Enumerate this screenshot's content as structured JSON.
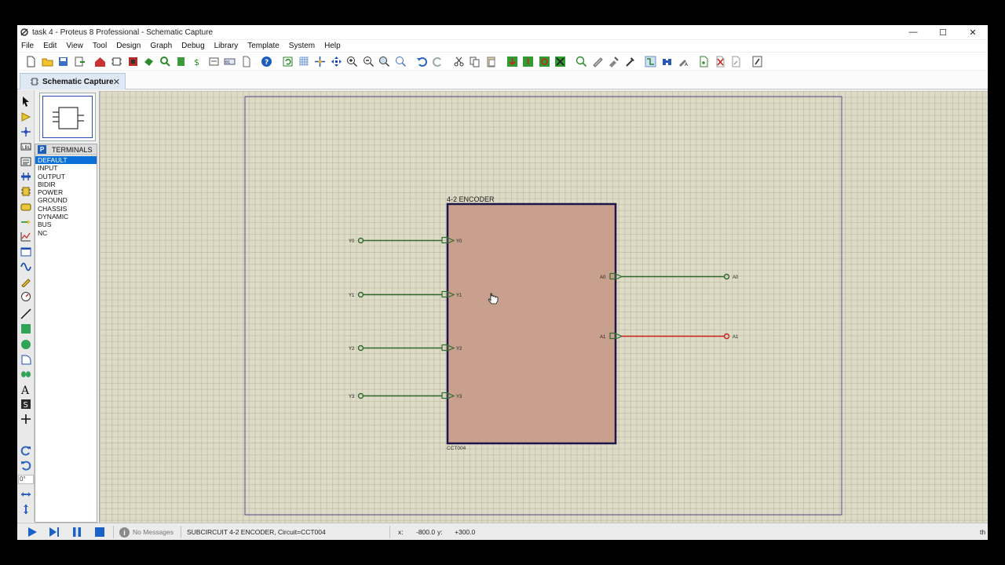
{
  "window": {
    "title": "task 4 - Proteus 8 Professional - Schematic Capture",
    "minimize": "—",
    "maximize": "☐",
    "close": "✕"
  },
  "menu": [
    "File",
    "Edit",
    "View",
    "Tool",
    "Design",
    "Graph",
    "Debug",
    "Library",
    "Template",
    "System",
    "Help"
  ],
  "tab": {
    "label": "Schematic Capture",
    "close": "✕"
  },
  "terminals": {
    "badge": "P",
    "header": "TERMINALS",
    "items": [
      "DEFAULT",
      "INPUT",
      "OUTPUT",
      "BIDIR",
      "POWER",
      "GROUND",
      "CHASSIS",
      "DYNAMIC",
      "BUS",
      "NC"
    ],
    "selected": "DEFAULT"
  },
  "rotation_value": "0°",
  "schematic": {
    "block_name": "4-2 ENCODER",
    "block_ref": "CCT004",
    "block_color": "#c9a08e",
    "wire_color_in": "#2f6b2f",
    "wire_color_out": "#2f6b2f",
    "wire_color_highlight": "#cc2222",
    "inputs": [
      {
        "label": "Y0",
        "pin": "Y0"
      },
      {
        "label": "Y1",
        "pin": "Y1"
      },
      {
        "label": "Y2",
        "pin": "Y2"
      },
      {
        "label": "Y3",
        "pin": "Y3"
      }
    ],
    "outputs": [
      {
        "label": "A0",
        "pin": "A0"
      },
      {
        "label": "A1",
        "pin": "A1"
      }
    ]
  },
  "status": {
    "messages": "No Messages",
    "info": "SUBCIRCUIT 4-2 ENCODER, Circuit=CCT004",
    "x_label": "x:",
    "x_value": "-800.0",
    "y_label": "y:",
    "y_value": "+300.0",
    "trailing": "th"
  }
}
